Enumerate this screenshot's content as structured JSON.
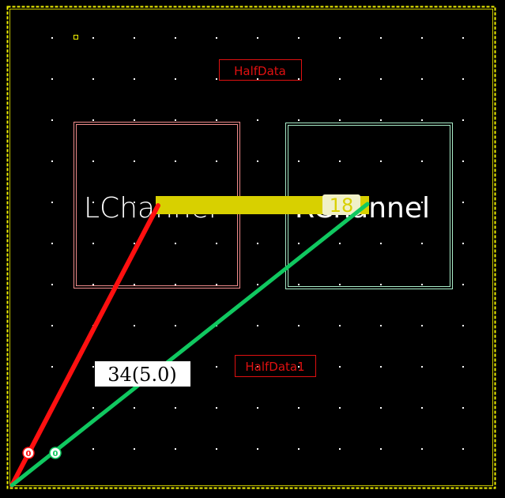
{
  "colors": {
    "background": "#000000",
    "border": "#f2f200",
    "grid_dot": "#ffffff",
    "left_box": "#f08c8c",
    "right_box": "#a8ecc8",
    "net_label": "#e01010",
    "wire": "#d8d000",
    "red_line": "#ff1010",
    "green_line": "#10c860",
    "channel_text": "#ffffff"
  },
  "labels": {
    "half_data_top": "HalfData",
    "half_data_bottom": "HalfData1",
    "left_channel": "LChannel",
    "right_channel": "RChannel",
    "wire_value": "18",
    "measure": "34(5.0)",
    "marker_red": "0",
    "marker_green": "0"
  }
}
